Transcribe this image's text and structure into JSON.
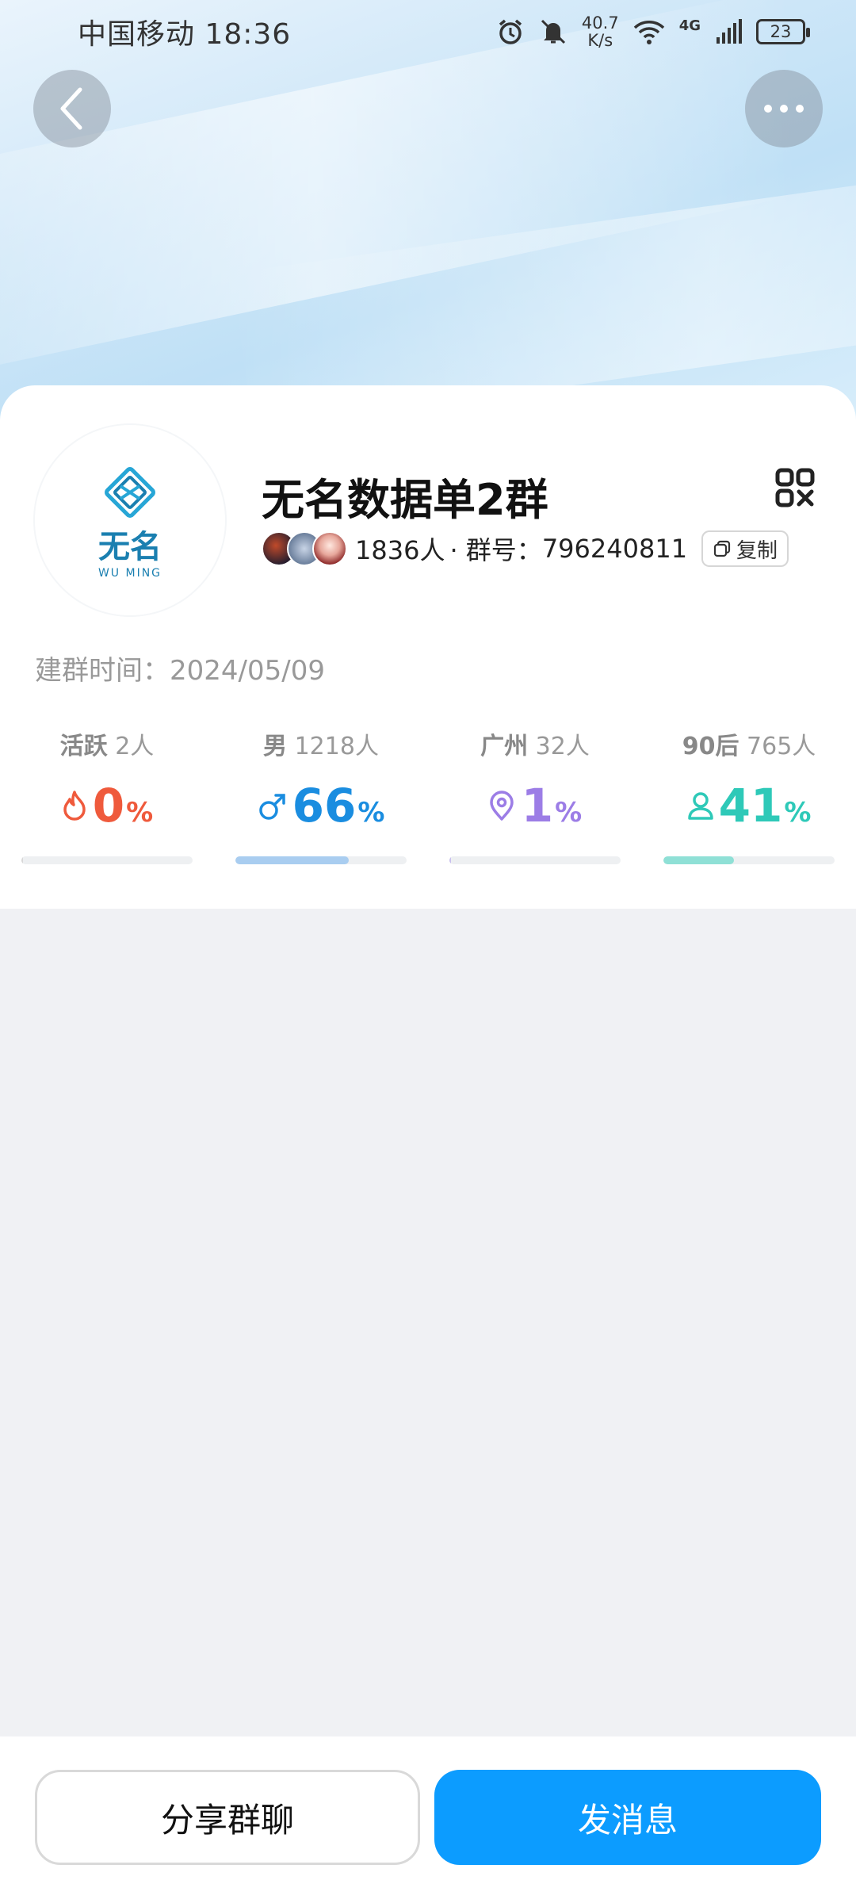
{
  "status_bar": {
    "carrier_time": "中国移动 18:36",
    "net_speed_value": "40.7",
    "net_speed_unit": "K/s",
    "network": "4G",
    "battery": "23"
  },
  "header": {
    "back_icon": "chevron-left-icon",
    "more_icon": "ellipsis-icon"
  },
  "group": {
    "logo_text": "无名",
    "logo_sub": "WU MING",
    "name": "无名数据单2群",
    "member_count": "1836人",
    "group_id_label": "· 群号：",
    "group_id": "796240811",
    "copy_label": "复制",
    "created_label": "建群时间：",
    "created_date": "2024/05/09"
  },
  "stats": [
    {
      "label": "活跃",
      "count": "2人",
      "value": "0",
      "unit": "%",
      "icon": "flame-icon",
      "color": "#ef5a3c",
      "fill": 0.0
    },
    {
      "label": "男",
      "count": "1218人",
      "value": "66",
      "unit": "%",
      "icon": "male-icon",
      "color": "#1a8de0",
      "fill": 0.66
    },
    {
      "label": "广州",
      "count": "32人",
      "value": "1",
      "unit": "%",
      "icon": "location-icon",
      "color": "#9c7de6",
      "fill": 0.01
    },
    {
      "label": "90后",
      "count": "765人",
      "value": "41",
      "unit": "%",
      "icon": "person-icon",
      "color": "#2ec9b8",
      "fill": 0.41
    }
  ],
  "bar_colors": [
    "#d8d8d8",
    "#a9cdf0",
    "#c9c0ee",
    "#8fe0d6"
  ],
  "actions": {
    "share_label": "分享群聊",
    "send_label": "发消息"
  }
}
